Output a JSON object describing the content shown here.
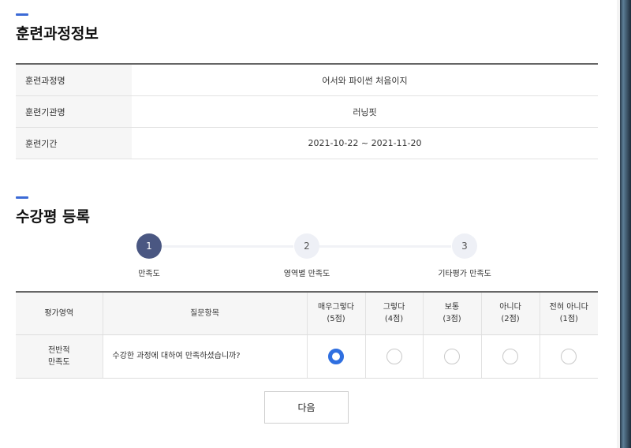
{
  "course_info": {
    "title": "훈련과정정보",
    "rows": [
      {
        "label": "훈련과정명",
        "value": "어서와 파이썬 처음이지"
      },
      {
        "label": "훈련기관명",
        "value": "러닝핏"
      },
      {
        "label": "훈련기간",
        "value": "2021-10-22 ~ 2021-11-20"
      }
    ]
  },
  "review": {
    "title": "수강평 등록",
    "steps": [
      {
        "number": "1",
        "label": "만족도",
        "active": true
      },
      {
        "number": "2",
        "label": "영역별 만족도",
        "active": false
      },
      {
        "number": "3",
        "label": "기타평가 만족도",
        "active": false
      }
    ],
    "table": {
      "headers": {
        "area": "평가영역",
        "question": "질문항목",
        "options": [
          {
            "line1": "매우그렇다",
            "line2": "(5점)"
          },
          {
            "line1": "그렇다",
            "line2": "(4점)"
          },
          {
            "line1": "보통",
            "line2": "(3점)"
          },
          {
            "line1": "아니다",
            "line2": "(2점)"
          },
          {
            "line1": "전혀 아니다",
            "line2": "(1점)"
          }
        ]
      },
      "row": {
        "area_line1": "전반적",
        "area_line2": "만족도",
        "question": "수강한 과정에 대하여 만족하셨습니까?",
        "selected_index": 0
      }
    },
    "next_label": "다음"
  },
  "colors": {
    "accent": "#3b6ad6",
    "step_active": "#4a5782",
    "radio_checked": "#2f6fe0"
  }
}
